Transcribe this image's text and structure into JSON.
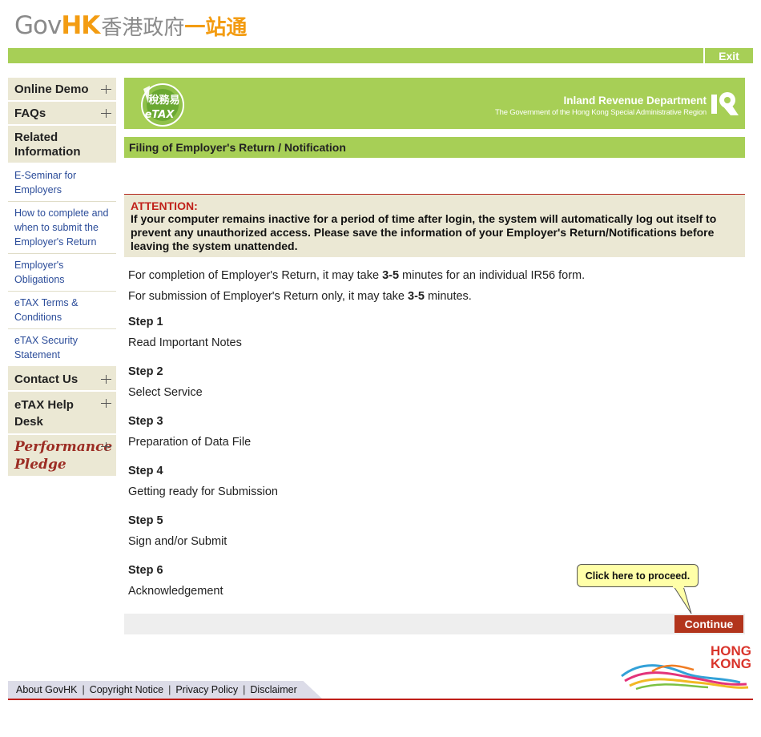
{
  "header": {
    "logo_gov": "Gov",
    "logo_hk": "HK",
    "logo_cn1": "香港政府",
    "logo_cn2": "一站通",
    "exit_label": "Exit"
  },
  "sidebar": {
    "online_demo": "Online Demo",
    "faqs": "FAQs",
    "related_information": "Related Information",
    "related_items": [
      "E-Seminar for Employers",
      "How to complete and when to submit the Employer's Return",
      "Employer's Obligations",
      "eTAX Terms & Conditions",
      "eTAX Security Statement"
    ],
    "contact_us": "Contact Us",
    "help_desk": "eTAX Help Desk",
    "pledge_line1": "Performance",
    "pledge_line2": "Pledge"
  },
  "banner": {
    "etax_cn": "稅務易",
    "etax_en": "eTAX",
    "ird_name": "Inland Revenue Department",
    "ird_sub": "The Government of the Hong Kong Special Administrative Region"
  },
  "main": {
    "section_title": "Filing of Employer's Return / Notification",
    "attention_title": "ATTENTION:",
    "attention_body": "If your computer remains inactive for a period of time after login, the system will automatically log out itself to prevent any unauthorized access. Please save the information of your Employer's Return/Notifications before leaving the system unattended.",
    "info1_pre": "For completion of Employer's Return, it may take ",
    "info1_bold": "3-5",
    "info1_post": " minutes for an individual IR56 form.",
    "info2_pre": "For submission of Employer's Return only, it may take ",
    "info2_bold": "3-5",
    "info2_post": " minutes.",
    "steps": [
      {
        "heading": "Step 1",
        "text": "Read Important Notes"
      },
      {
        "heading": "Step 2",
        "text": "Select Service"
      },
      {
        "heading": "Step 3",
        "text": "Preparation of Data File"
      },
      {
        "heading": "Step 4",
        "text": "Getting ready for Submission"
      },
      {
        "heading": "Step 5",
        "text": "Sign and/or Submit"
      },
      {
        "heading": "Step 6",
        "text": "Acknowledgement"
      }
    ],
    "tooltip": "Click here to proceed.",
    "continue_label": "Continue"
  },
  "footer": {
    "links": [
      "About GovHK",
      "Copyright Notice",
      "Privacy Policy",
      "Disclaimer"
    ],
    "brand_line1": "HONG",
    "brand_line2": "KONG"
  },
  "colors": {
    "green": "#a7cf56",
    "beige": "#ebe8d4",
    "accent_red": "#b2341c",
    "link_blue": "#2c4d9a"
  }
}
